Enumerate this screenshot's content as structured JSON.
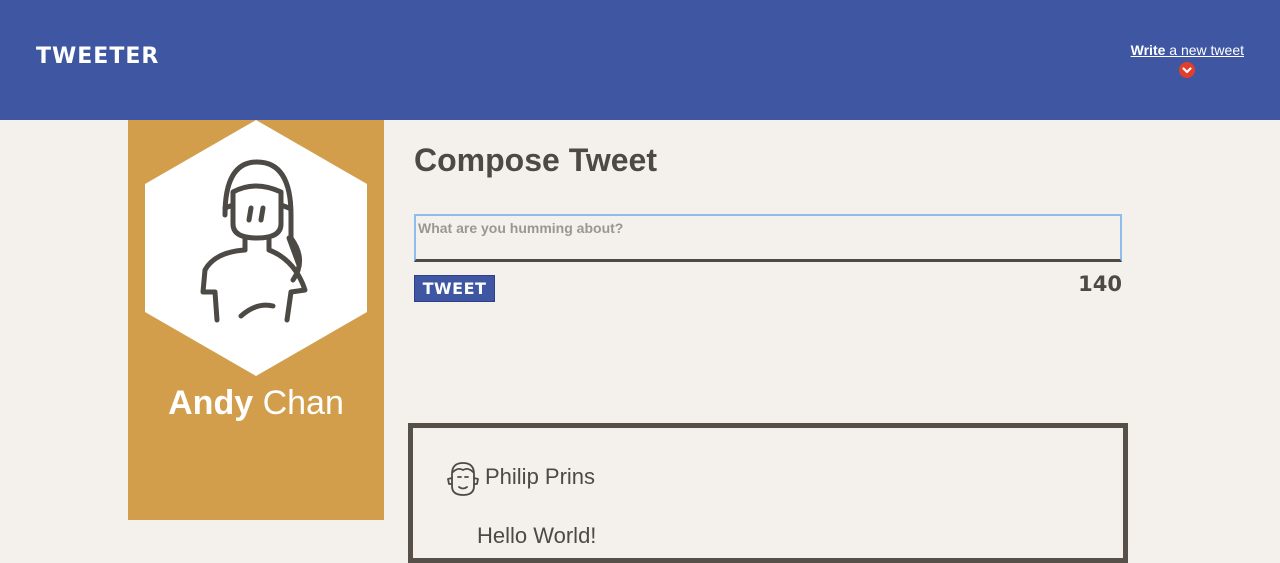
{
  "header": {
    "logo": "TWEETER",
    "compose_link_bold": "Write",
    "compose_link_rest": " a new tweet"
  },
  "profile": {
    "first_name": "Andy",
    "last_name": " Chan"
  },
  "compose": {
    "title": "Compose Tweet",
    "placeholder": "What are you humming about?",
    "button_label": "TWEET",
    "char_counter": "140"
  },
  "tweets": [
    {
      "author": "Philip Prins",
      "text": "Hello World!"
    }
  ],
  "colors": {
    "header": "#3f56a2",
    "profile_panel": "#d39e4b",
    "background": "#f4f1ec",
    "text": "#4d4a45",
    "accent_red": "#e33e2b"
  }
}
